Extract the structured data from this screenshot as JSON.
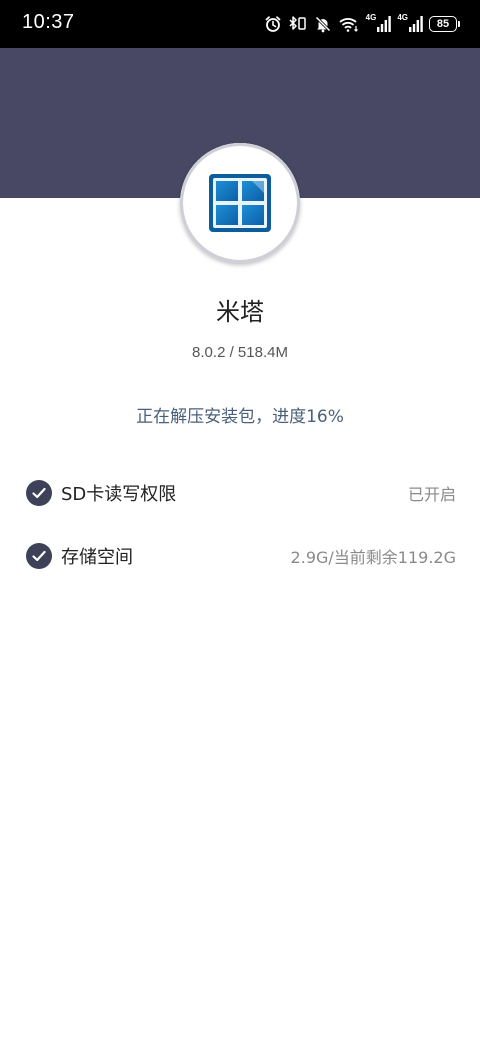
{
  "status_bar": {
    "time": "10:37",
    "battery": "85",
    "signal1_label": "4G",
    "signal2_label": "4G"
  },
  "colors": {
    "header": "#484864",
    "check": "#3d4258",
    "progress_text": "#4a5f7a"
  },
  "app": {
    "name": "米塔",
    "version_size": "8.0.2 / 518.4M",
    "icon": "window-app-icon"
  },
  "install": {
    "status_text": "正在解压安装包，进度16%",
    "progress_percent": 16
  },
  "permissions": [
    {
      "label": "SD卡读写权限",
      "value": "已开启",
      "icon": "check-circle-icon"
    },
    {
      "label": "存储空间",
      "value": "2.9G/当前剩余119.2G",
      "icon": "check-circle-icon"
    }
  ]
}
